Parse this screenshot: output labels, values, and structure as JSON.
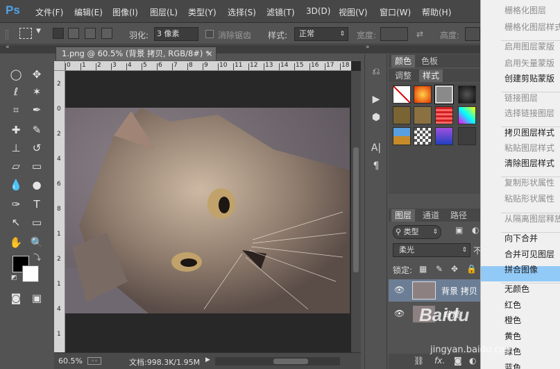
{
  "app": {
    "logo": "Ps"
  },
  "menubar": [
    "文件(F)",
    "编辑(E)",
    "图像(I)",
    "图层(L)",
    "类型(Y)",
    "选择(S)",
    "滤镜(T)",
    "3D(D)",
    "视图(V)",
    "窗口(W)",
    "帮助(H)"
  ],
  "options": {
    "feather_label": "羽化:",
    "feather_value": "3 像素",
    "antialias_label": "消除锯齿",
    "style_label": "样式:",
    "style_value": "正常",
    "width_label": "宽度:",
    "height_label": "高度:"
  },
  "document": {
    "tab_title": "1.png @ 60.5% (背景 拷贝, RGB/8#) *",
    "close": "×",
    "ruler_top": [
      "0",
      "1",
      "2",
      "3",
      "4",
      "5",
      "6",
      "7",
      "8",
      "9",
      "10",
      "11",
      "12",
      "13",
      "14",
      "15",
      "16",
      "17",
      "18"
    ],
    "ruler_left": [
      "2",
      "0",
      "2",
      "4",
      "6",
      "8",
      "1",
      "2",
      "1",
      "4",
      "1"
    ],
    "zoom": "60.5%",
    "doc_size": "文档:998.3K/1.95M"
  },
  "panels": {
    "color_tabs": [
      "颜色",
      "色板"
    ],
    "style_tabs": [
      "调整",
      "样式"
    ],
    "layer_tabs": [
      "图层",
      "通道",
      "路径"
    ],
    "filter_label": "类型",
    "blend_mode": "柔光",
    "opacity_prefix": "不",
    "lock_label": "锁定:",
    "layers": [
      {
        "name": "背景 拷贝",
        "selected": true
      },
      {
        "name": "背景",
        "selected": false
      }
    ],
    "fx_label": "fx."
  },
  "context_menu": {
    "items": [
      {
        "label": "栅格化图层",
        "disabled": true
      },
      {
        "label": "栅格化图层样式",
        "disabled": true
      },
      {
        "label": "启用图层蒙版",
        "disabled": true
      },
      {
        "label": "启用矢量蒙版",
        "disabled": true
      },
      {
        "label": "创建剪贴蒙版",
        "disabled": false
      },
      {
        "label": "链接图层",
        "disabled": true
      },
      {
        "label": "选择链接图层",
        "disabled": true
      },
      {
        "label": "拷贝图层样式",
        "disabled": false
      },
      {
        "label": "粘贴图层样式",
        "disabled": true
      },
      {
        "label": "清除图层样式",
        "disabled": false
      },
      {
        "label": "复制形状属性",
        "disabled": true
      },
      {
        "label": "粘贴形状属性",
        "disabled": true
      },
      {
        "label": "从隔离图层释放",
        "disabled": true
      },
      {
        "label": "向下合并",
        "disabled": false
      },
      {
        "label": "合并可见图层",
        "disabled": false
      },
      {
        "label": "拼合图像",
        "disabled": false,
        "highlighted": true
      },
      {
        "label": "无颜色",
        "disabled": false
      },
      {
        "label": "红色",
        "disabled": false
      },
      {
        "label": "橙色",
        "disabled": false
      },
      {
        "label": "黄色",
        "disabled": false
      },
      {
        "label": "绿色",
        "disabled": false
      },
      {
        "label": "蓝色",
        "disabled": false
      }
    ]
  },
  "watermark": "Baidu 经验  jingyan.baidu.com",
  "colors": {
    "menu_highlight": "#91c9f7",
    "ps_blue": "#4fa3e8"
  }
}
